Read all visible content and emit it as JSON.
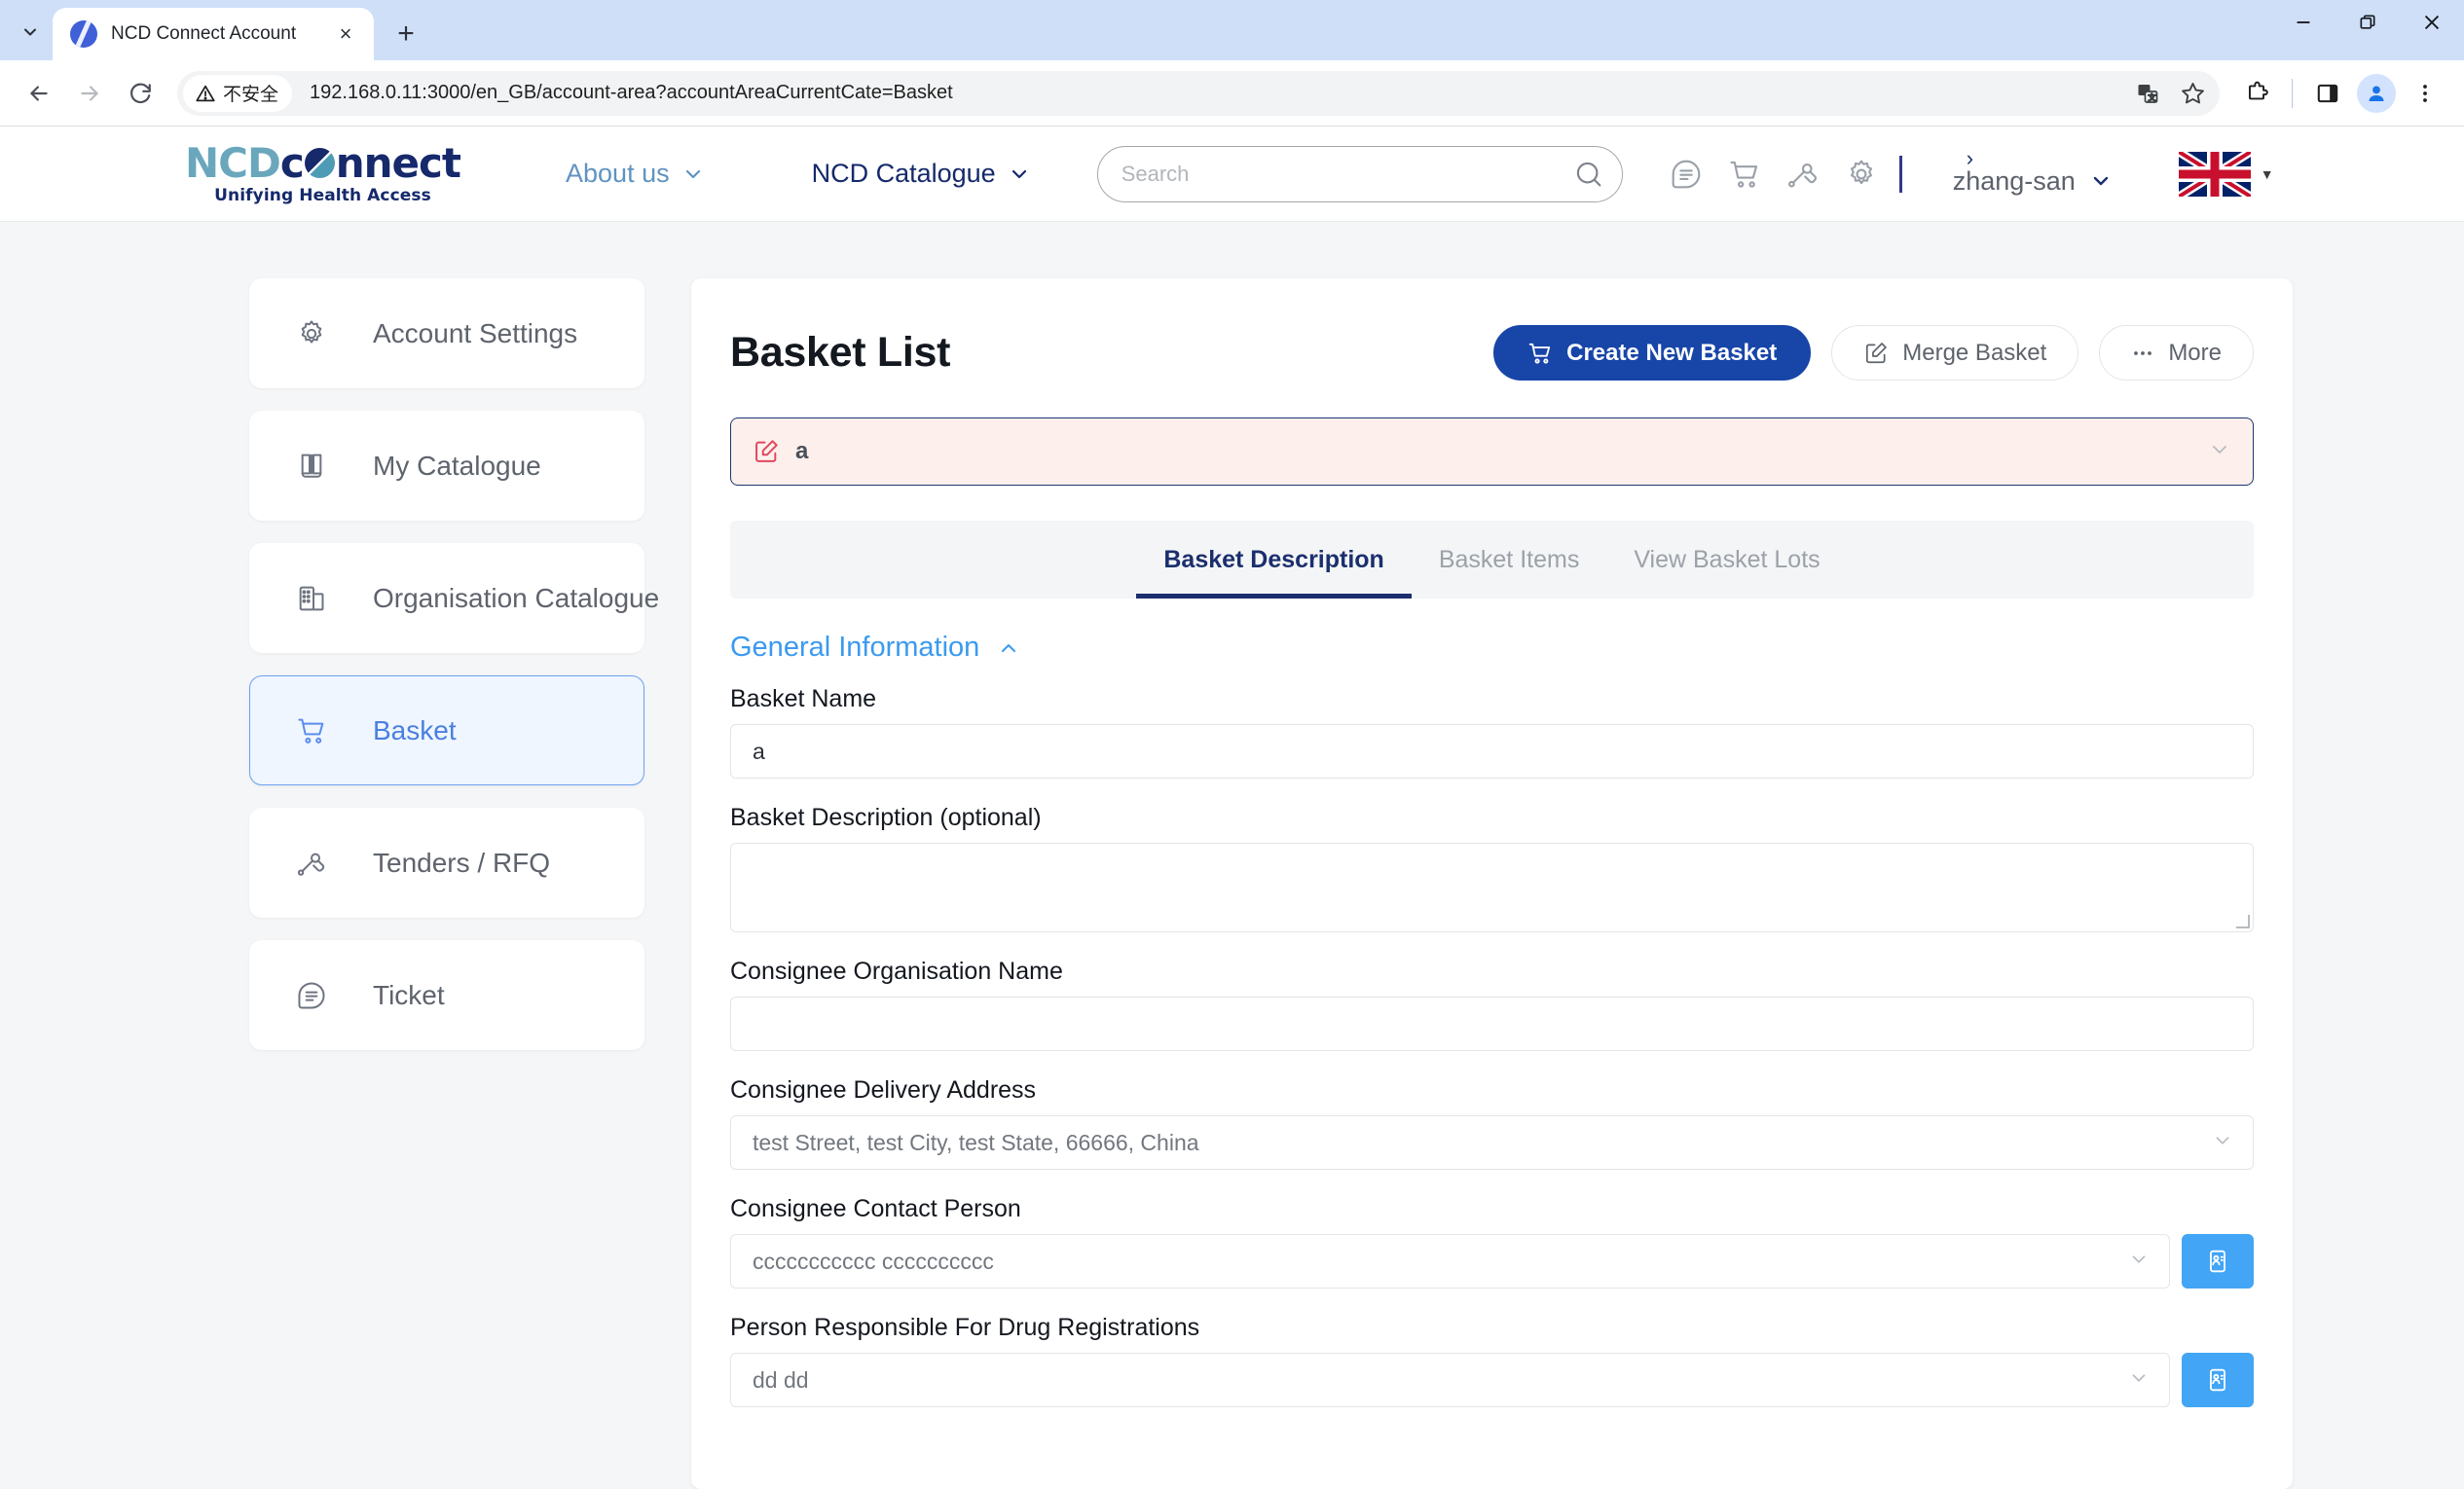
{
  "browser": {
    "tab_title": "NCD Connect Account",
    "url": "192.168.0.11:3000/en_GB/account-area?accountAreaCurrentCate=Basket",
    "security_label": "不安全",
    "new_tab_label": "+",
    "close_tab_label": "×"
  },
  "site_header": {
    "logo_ncd": "NCD",
    "logo_c": "c",
    "logo_onnect": "nnect",
    "logo_tagline": "Unifying Health Access",
    "nav": [
      {
        "label": "About us"
      },
      {
        "label": "NCD Catalogue"
      }
    ],
    "search": {
      "value": "",
      "placeholder": "Search"
    },
    "icons": [
      "ticket-icon",
      "cart-icon",
      "tender-gavel-icon",
      "gear-icon"
    ],
    "user": {
      "name": "zhang-san"
    },
    "language": {
      "flag": "uk-flag"
    }
  },
  "sidebar": {
    "items": [
      {
        "label": "Account Settings",
        "icon": "gear-icon",
        "active": false
      },
      {
        "label": "My Catalogue",
        "icon": "book-icon",
        "active": false
      },
      {
        "label": "Organisation Catalogue",
        "icon": "building-icon",
        "active": false
      },
      {
        "label": "Basket",
        "icon": "cart-icon",
        "active": true
      },
      {
        "label": "Tenders / RFQ",
        "icon": "gavel-icon",
        "active": false
      },
      {
        "label": "Ticket",
        "icon": "ticket-icon",
        "active": false
      }
    ]
  },
  "main": {
    "title": "Basket List",
    "actions": {
      "create": "Create New Basket",
      "merge": "Merge Basket",
      "more": "More"
    },
    "basket_selector": {
      "value": "a",
      "icon": "edit-square-icon"
    },
    "tabs": [
      {
        "label": "Basket Description",
        "active": true
      },
      {
        "label": "Basket Items",
        "active": false
      },
      {
        "label": "View Basket Lots",
        "active": false
      }
    ],
    "section": {
      "title": "General Information",
      "collapsed": false
    },
    "fields": {
      "basket_name": {
        "label": "Basket Name",
        "value": "a"
      },
      "basket_description": {
        "label": "Basket Description (optional)",
        "value": ""
      },
      "consignee_org": {
        "label": "Consignee Organisation Name",
        "value": ""
      },
      "delivery_address": {
        "label": "Consignee Delivery Address",
        "value": "test Street,  test City,  test State,  66666, China"
      },
      "contact_person": {
        "label": "Consignee Contact Person",
        "value": "ccccccccccc cccccccccc"
      },
      "drug_reg_person": {
        "label": "Person Responsible For Drug Registrations",
        "value": "dd dd"
      }
    }
  },
  "colors": {
    "primary": "#1845a8",
    "accent_blue": "#42a5f5",
    "link_blue": "#3b9aef",
    "navy": "#15296b",
    "alert_bg": "#fdf0ec",
    "alert_icon": "#e0475e"
  }
}
